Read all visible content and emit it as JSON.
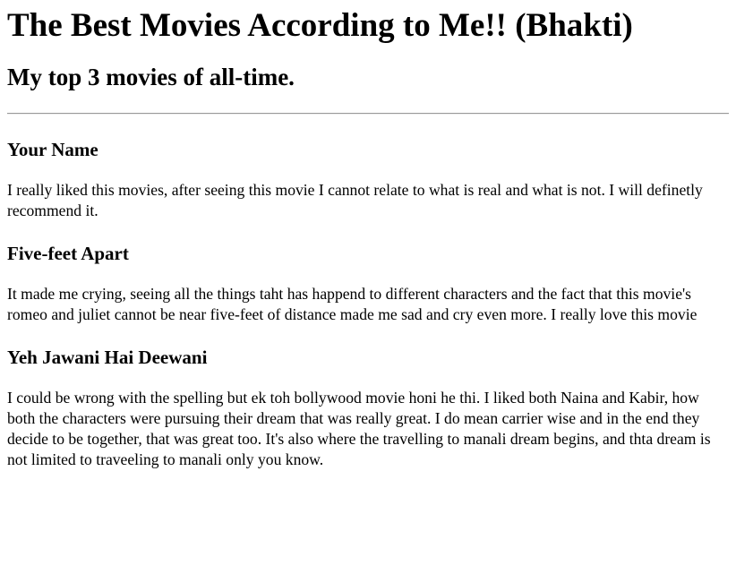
{
  "page": {
    "title": "The Best Movies According to Me!! (Bhakti)",
    "subtitle": "My top 3 movies of all-time."
  },
  "movies": [
    {
      "title": "Your Name",
      "review": "I really liked this movies, after seeing this movie I cannot relate to what is real and what is not. I will definetly recommend it."
    },
    {
      "title": "Five-feet Apart",
      "review": "It made me crying, seeing all the things taht has happend to different characters and the fact that this movie's romeo and juliet cannot be near five-feet of distance made me sad and cry even more. I really love this movie"
    },
    {
      "title": "Yeh Jawani Hai Deewani",
      "review": "I could be wrong with the spelling but ek toh bollywood movie honi he thi. I liked both Naina and Kabir, how both the characters were pursuing their dream that was really great. I do mean carrier wise and in the end they decide to be together, that was great too. It's also where the travelling to manali dream begins, and thta dream is not limited to traveeling to manali only you know."
    }
  ]
}
